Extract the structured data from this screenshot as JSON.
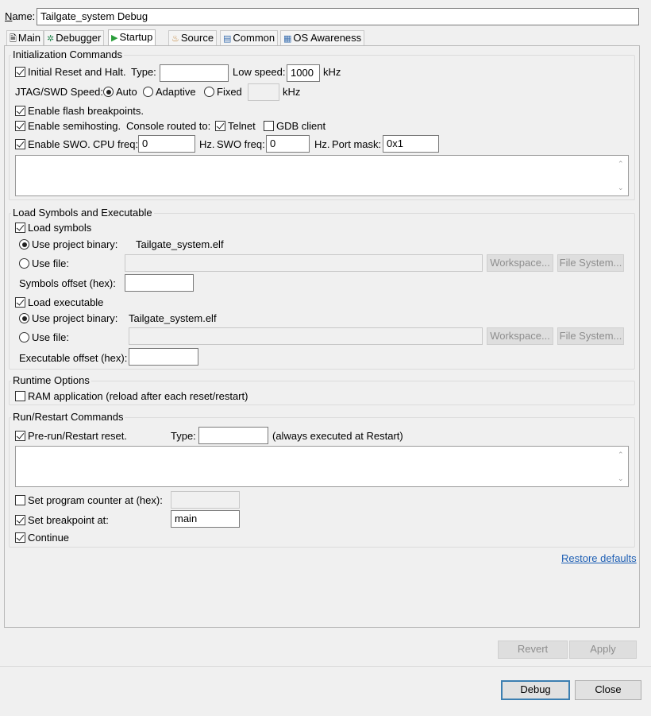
{
  "name": {
    "label": "Name:",
    "value": "Tailgate_system Debug"
  },
  "tabs": [
    {
      "label": "Main",
      "icon": "page-icon"
    },
    {
      "label": "Debugger",
      "icon": "debugger-icon"
    },
    {
      "label": "Startup",
      "icon": "play-icon"
    },
    {
      "label": "Source",
      "icon": "source-icon"
    },
    {
      "label": "Common",
      "icon": "common-icon"
    },
    {
      "label": "OS Awareness",
      "icon": "os-icon"
    }
  ],
  "init": {
    "title": "Initialization Commands",
    "reset_label": "Initial Reset and Halt.",
    "type_label": "Type:",
    "type_value": "",
    "low_speed_label": "Low speed:",
    "low_speed_value": "1000",
    "khz": "kHz",
    "jtag_label": "JTAG/SWD Speed:",
    "auto": "Auto",
    "adaptive": "Adaptive",
    "fixed": "Fixed",
    "fixed_value": "",
    "khz2": "kHz",
    "flash_bp": "Enable flash breakpoints.",
    "semihosting": "Enable semihosting.",
    "console_label": "Console routed to:",
    "telnet": "Telnet",
    "gdb_client": "GDB client",
    "swo": "Enable SWO.",
    "cpu_freq_label": "CPU freq:",
    "cpu_freq_value": "0",
    "hz1": "Hz.",
    "swo_freq_label": "SWO freq:",
    "swo_freq_value": "0",
    "hz2": "Hz.",
    "port_mask_label": "Port mask:",
    "port_mask_value": "0x1"
  },
  "load": {
    "title": "Load Symbols and Executable",
    "load_symbols": "Load symbols",
    "use_project_binary": "Use project binary:",
    "symbols_binary": "Tailgate_system.elf",
    "use_file": "Use file:",
    "workspace": "Workspace...",
    "file_system": "File System...",
    "symbols_offset_label": "Symbols offset (hex):",
    "symbols_offset_value": "",
    "load_executable": "Load executable",
    "use_project_binary2": "Use project binary:",
    "exec_binary": "Tailgate_system.elf",
    "use_file2": "Use file:",
    "workspace2": "Workspace...",
    "file_system2": "File System...",
    "exec_offset_label": "Executable offset (hex):",
    "exec_offset_value": ""
  },
  "runtime": {
    "title": "Runtime Options",
    "ram_app": "RAM application (reload after each reset/restart)"
  },
  "run": {
    "title": "Run/Restart Commands",
    "prerun": "Pre-run/Restart reset.",
    "type_label": "Type:",
    "type_value": "",
    "always": "(always executed at Restart)",
    "set_pc": "Set program counter at (hex):",
    "set_pc_value": "",
    "set_bp": "Set breakpoint at:",
    "set_bp_value": "main",
    "continue": "Continue"
  },
  "restore_defaults": "Restore defaults",
  "buttons": {
    "revert": "Revert",
    "apply": "Apply",
    "debug": "Debug",
    "close": "Close"
  }
}
